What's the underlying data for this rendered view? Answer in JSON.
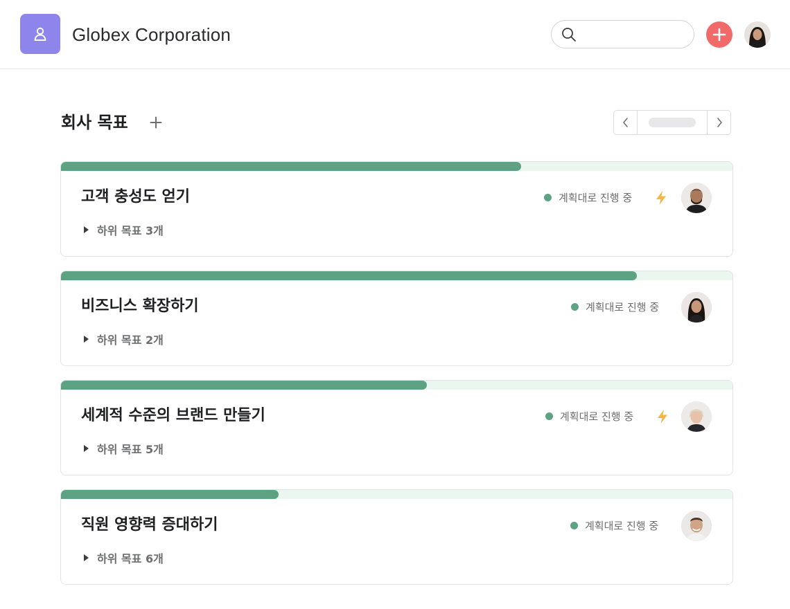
{
  "header": {
    "company_name": "Globex Corporation",
    "search_placeholder": "",
    "logo_icon": "user-circle-icon",
    "add_icon": "plus-icon",
    "brand_color": "#8d84ec",
    "accent_color": "#f06a6a"
  },
  "section": {
    "title": "회사 목표",
    "add_icon": "plus-icon",
    "pager_prev_icon": "chevron-left-icon",
    "pager_next_icon": "chevron-right-icon"
  },
  "status_color": "#5da283",
  "goals": [
    {
      "title": "고객 충성도 얻기",
      "subgoals": "하위 목표 3개",
      "status": "계획대로 진행 중",
      "progress": 0.685,
      "has_bolt": true
    },
    {
      "title": "비즈니스 확장하기",
      "subgoals": "하위 목표 2개",
      "status": "계획대로 진행 중",
      "progress": 0.858,
      "has_bolt": false
    },
    {
      "title": "세계적 수준의 브랜드 만들기",
      "subgoals": "하위 목표 5개",
      "status": "계획대로 진행 중",
      "progress": 0.545,
      "has_bolt": true
    },
    {
      "title": "직원 영향력 증대하기",
      "subgoals": "하위 목표 6개",
      "status": "계획대로 진행 중",
      "progress": 0.324,
      "has_bolt": false
    }
  ]
}
